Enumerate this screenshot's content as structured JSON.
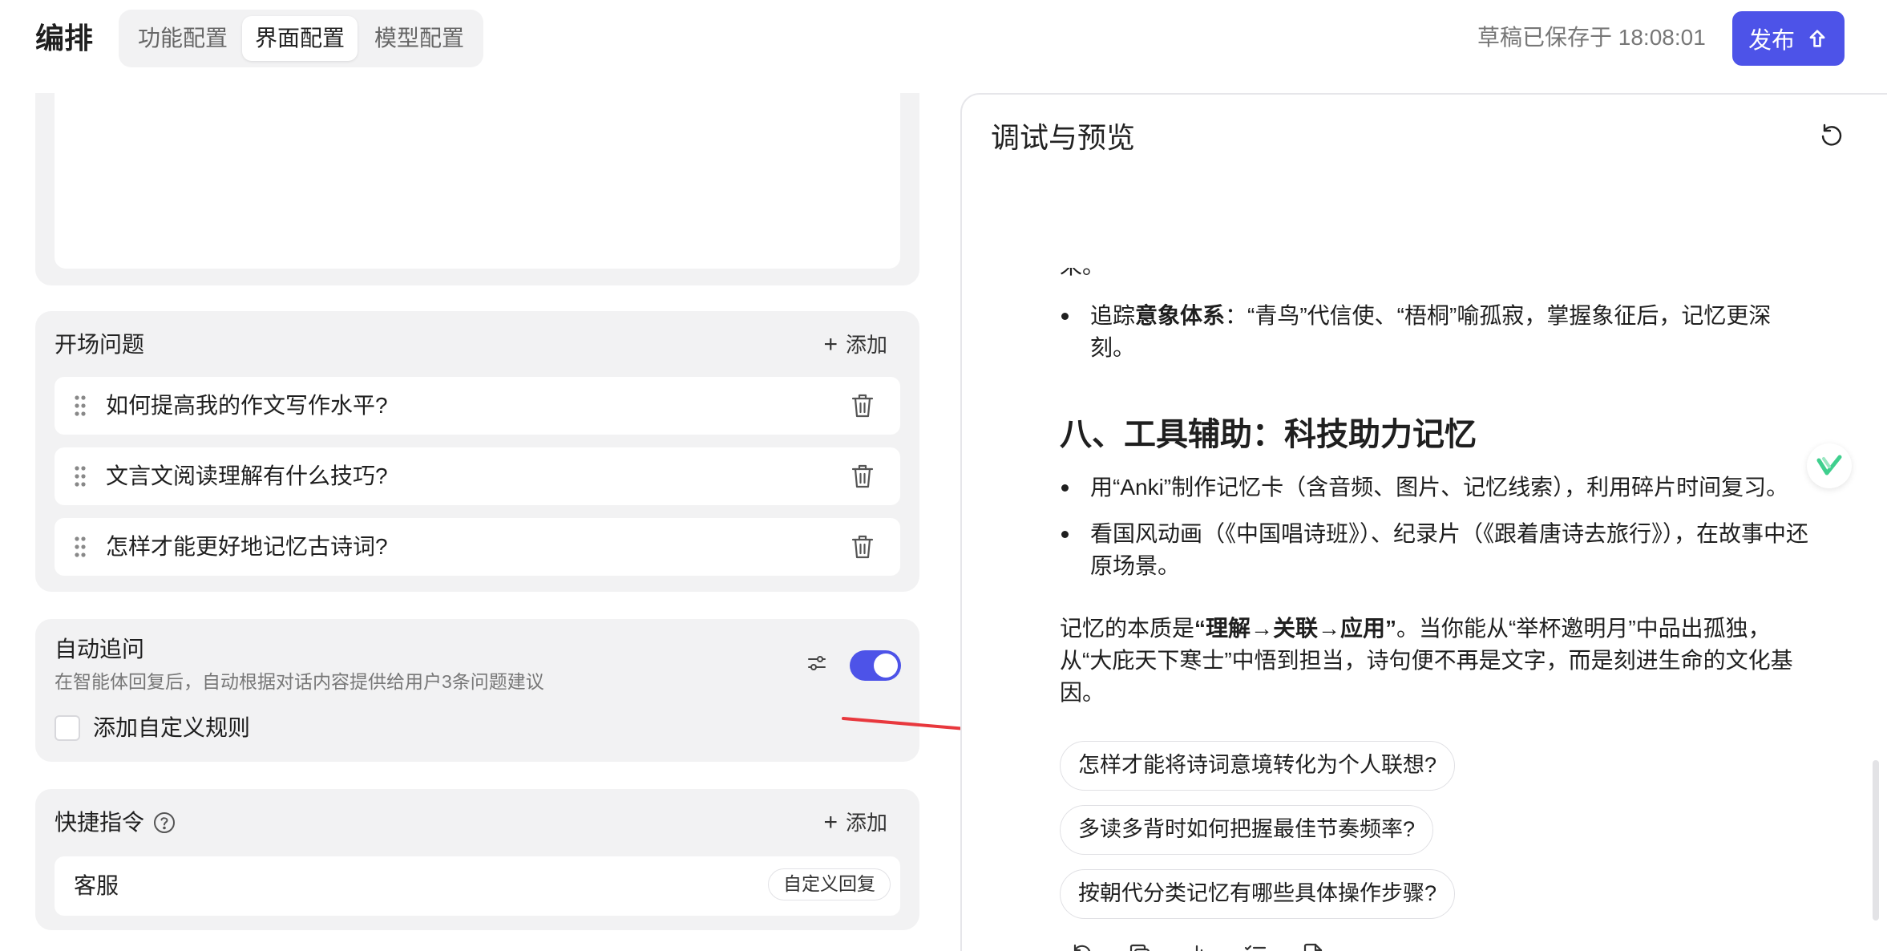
{
  "header": {
    "title": "编排",
    "tabs": [
      {
        "label": "功能配置"
      },
      {
        "label": "界面配置"
      },
      {
        "label": "模型配置"
      }
    ],
    "saved_status": "草稿已保存于 18:08:01",
    "publish_label": "发布"
  },
  "opener": {
    "title": "开场问题",
    "add_label": "添加",
    "questions": [
      "如何提高我的作文写作水平?",
      "文言文阅读理解有什么技巧?",
      "怎样才能更好地记忆古诗词?"
    ]
  },
  "follow_up": {
    "title": "自动追问",
    "description": "在智能体回复后，自动根据对话内容提供给用户3条问题建议",
    "custom_rule_label": "添加自定义规则",
    "enabled": true
  },
  "shortcut": {
    "title": "快捷指令",
    "add_label": "添加",
    "items": [
      {
        "name": "客服",
        "tag": "自定义回复"
      }
    ]
  },
  "preview": {
    "title": "调试与预览",
    "clipped_text": "来。",
    "bullet1": {
      "prefix": "追踪",
      "bold": "意象体系",
      "rest": "：“青鸟”代信使、“梧桐”喻孤寂，掌握象征后，记忆更深刻。"
    },
    "heading": "八、工具辅助：科技助力记忆",
    "bullet2": "用“Anki”制作记忆卡（含音频、图片、记忆线索），利用碎片时间复习。",
    "bullet3": "看国风动画（《中国唱诗班》）、纪录片（《跟着唐诗去旅行》），在故事中还原场景。",
    "para": {
      "prefix": "记忆的本质是",
      "bold": "“理解→关联→应用”",
      "rest": "。当你能从“举杯邀明月”中品出孤独，从“大庇天下寒士”中悟到担当，诗句便不再是文字，而是刻进生命的文化基因。"
    },
    "suggestions": [
      "怎样才能将诗词意境转化为个人联想?",
      "多读多背时如何把握最佳节奏频率?",
      "按朝代分类记忆有哪些具体操作步骤?"
    ]
  },
  "colors": {
    "accent": "#4d53e8",
    "panel_bg": "#f2f2f3",
    "annotation_arrow": "#e8383d"
  }
}
